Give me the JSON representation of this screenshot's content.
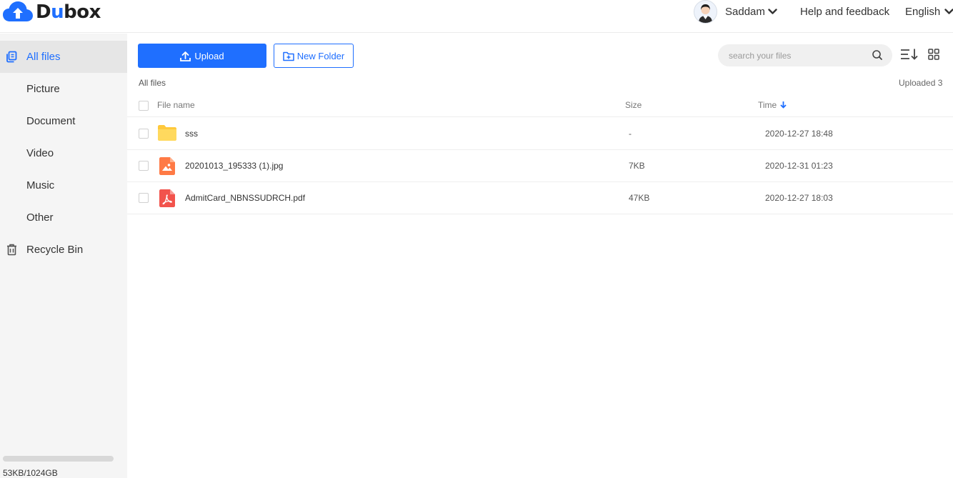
{
  "header": {
    "logo_prefix": "D",
    "logo_u": "u",
    "logo_suffix": "box",
    "user_name": "Saddam",
    "help": "Help and feedback",
    "language": "English"
  },
  "sidebar": {
    "items": [
      {
        "label": "All files",
        "active": true
      },
      {
        "label": "Picture"
      },
      {
        "label": "Document"
      },
      {
        "label": "Video"
      },
      {
        "label": "Music"
      },
      {
        "label": "Other"
      },
      {
        "label": "Recycle Bin"
      }
    ],
    "quota_text": "53KB/1024GB",
    "quota_fraction": 0.0
  },
  "toolbar": {
    "upload_label": "Upload",
    "new_folder_label": "New Folder",
    "search_placeholder": "search your files"
  },
  "breadcrumb": "All files",
  "uploaded_text": "Uploaded 3",
  "table": {
    "columns": {
      "name": "File name",
      "size": "Size",
      "time": "Time"
    },
    "sort": {
      "column": "time",
      "direction": "desc"
    },
    "rows": [
      {
        "name": "sss",
        "type": "folder",
        "size": "-",
        "time": "2020-12-27 18:48"
      },
      {
        "name": "20201013_195333 (1).jpg",
        "type": "image",
        "size": "7KB",
        "time": "2020-12-31 01:23"
      },
      {
        "name": "AdmitCard_NBNSSUDRCH.pdf",
        "type": "pdf",
        "size": "47KB",
        "time": "2020-12-27 18:03"
      }
    ]
  },
  "colors": {
    "accent": "#1f6fff",
    "folder": "#ffc93c",
    "image_icon": "#ff7a45",
    "pdf_icon": "#f2534c"
  }
}
